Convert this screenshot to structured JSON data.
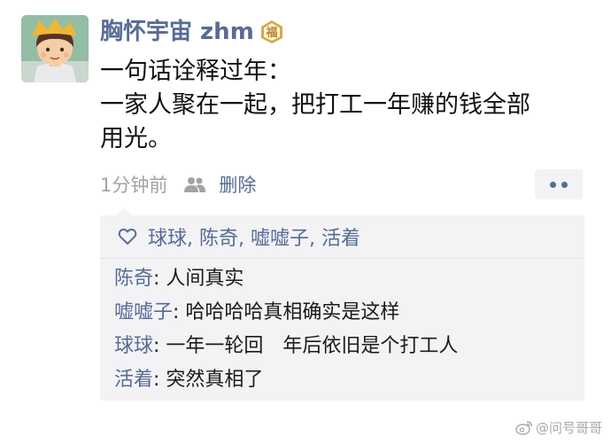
{
  "post": {
    "author_name": "胸怀宇宙 zhm",
    "badge_text": "福",
    "text_lines": [
      "一句话诠释过年：",
      "一家人聚在一起，把打工一年赚的钱全部",
      "用光。"
    ],
    "time": "1分钟前",
    "delete_label": "删除"
  },
  "likes": {
    "names": "球球, 陈奇, 嘘嘘子, 活着"
  },
  "comments": [
    {
      "author": "陈奇",
      "separator": ": ",
      "text": "人间真实"
    },
    {
      "author": "嘘嘘子",
      "separator": ": ",
      "text": "哈哈哈哈真相确实是这样"
    },
    {
      "author": "球球",
      "separator": ": ",
      "text": "一年一轮回　年后依旧是个打工人"
    },
    {
      "author": "活着",
      "separator": ": ",
      "text": "突然真相了"
    }
  ],
  "watermark": {
    "text": "@问号哥哥"
  },
  "colors": {
    "link_blue": "#576b95",
    "meta_gray": "#a3a3a3",
    "comment_bg": "#f3f3f5",
    "badge_gold": "#d4a94a"
  },
  "icons": {
    "avatar": "cartoon-boy-avatar",
    "badge": "fu-badge-icon",
    "visibility": "people-icon",
    "more": "more-dots-icon",
    "like": "heart-outline-icon",
    "watermark": "weibo-logo-icon"
  }
}
